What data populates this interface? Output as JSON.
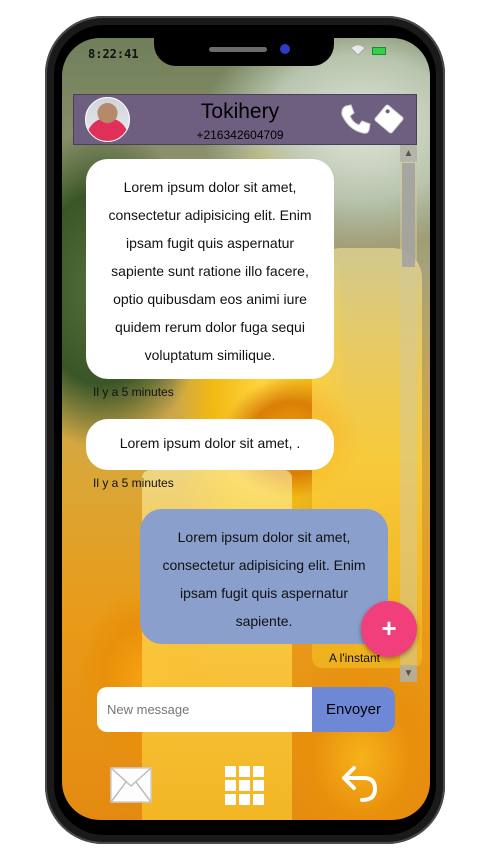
{
  "status_bar": {
    "time": "8:22:41"
  },
  "header": {
    "contact_name": "Tokihery",
    "contact_phone": "+216342604709",
    "icons": [
      "avatar",
      "phone-icon",
      "tag-icon"
    ]
  },
  "messages": [
    {
      "direction": "incoming",
      "text": "Lorem ipsum dolor sit amet, consectetur adipisicing elit. Enim ipsam fugit quis aspernatur sapiente sunt ratione illo facere, optio quibusdam eos animi iure quidem rerum dolor fuga sequi voluptatum similique.",
      "time": "Il y a 5 minutes"
    },
    {
      "direction": "incoming",
      "text": "Lorem ipsum dolor sit amet, .",
      "time": "Il y a 5 minutes"
    },
    {
      "direction": "outgoing",
      "text": "Lorem ipsum dolor sit amet, consectetur adipisicing elit. Enim ipsam fugit quis aspernatur sapiente.",
      "time": "A l'instant"
    }
  ],
  "fab": {
    "label": "+"
  },
  "composer": {
    "placeholder": "New message",
    "send_label": "Envoyer"
  },
  "bottom_nav": {
    "icons": [
      "mail-icon",
      "grid-icon",
      "back-arrow-icon"
    ]
  },
  "colors": {
    "header_bg": "#6e5f80",
    "outgoing_bubble": "#8a9fcb",
    "send_button": "#6f88d6",
    "fab": "#f13f7b"
  }
}
